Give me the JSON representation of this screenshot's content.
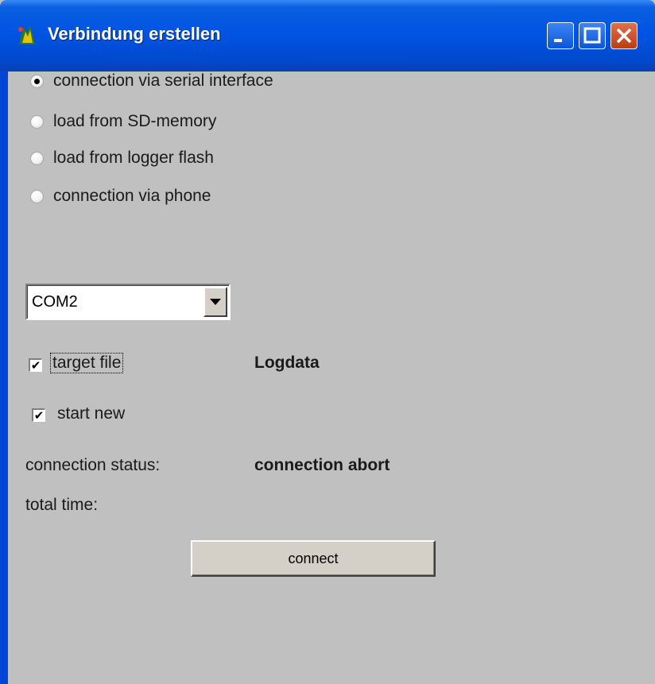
{
  "window": {
    "title": "Verbindung erstellen",
    "title_color": "#0054e3"
  },
  "connection_modes": [
    {
      "label": "connection via serial interface",
      "checked": true
    },
    {
      "label": "load from SD-memory",
      "checked": false
    },
    {
      "label": "load from logger flash",
      "checked": false
    },
    {
      "label": "connection via phone",
      "checked": false
    }
  ],
  "port": {
    "selected": "COM2"
  },
  "target_file": {
    "label": "target file",
    "checked": true,
    "value": "Logdata"
  },
  "start_new": {
    "label": "start new",
    "checked": true
  },
  "status": {
    "label": "connection status:",
    "value": "connection abort",
    "total_time_label": "total time:",
    "total_time_value": ""
  },
  "actions": {
    "connect_label": "connect"
  }
}
